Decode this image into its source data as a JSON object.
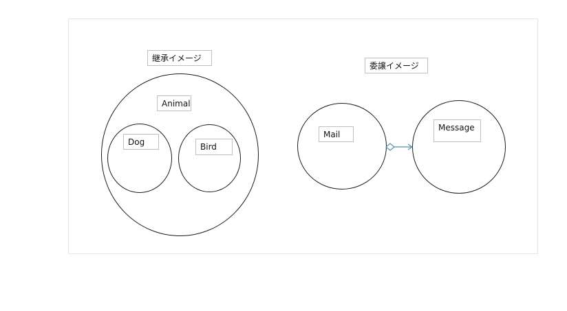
{
  "diagram": {
    "inheritance": {
      "title": "継承イメージ",
      "parent": "Animal",
      "children": [
        "Dog",
        "Bird"
      ]
    },
    "delegation": {
      "title": "委譲イメージ",
      "delegator": "Mail",
      "delegate": "Message",
      "connector": {
        "type": "aggregation",
        "color": "#5b8fa3"
      }
    }
  }
}
